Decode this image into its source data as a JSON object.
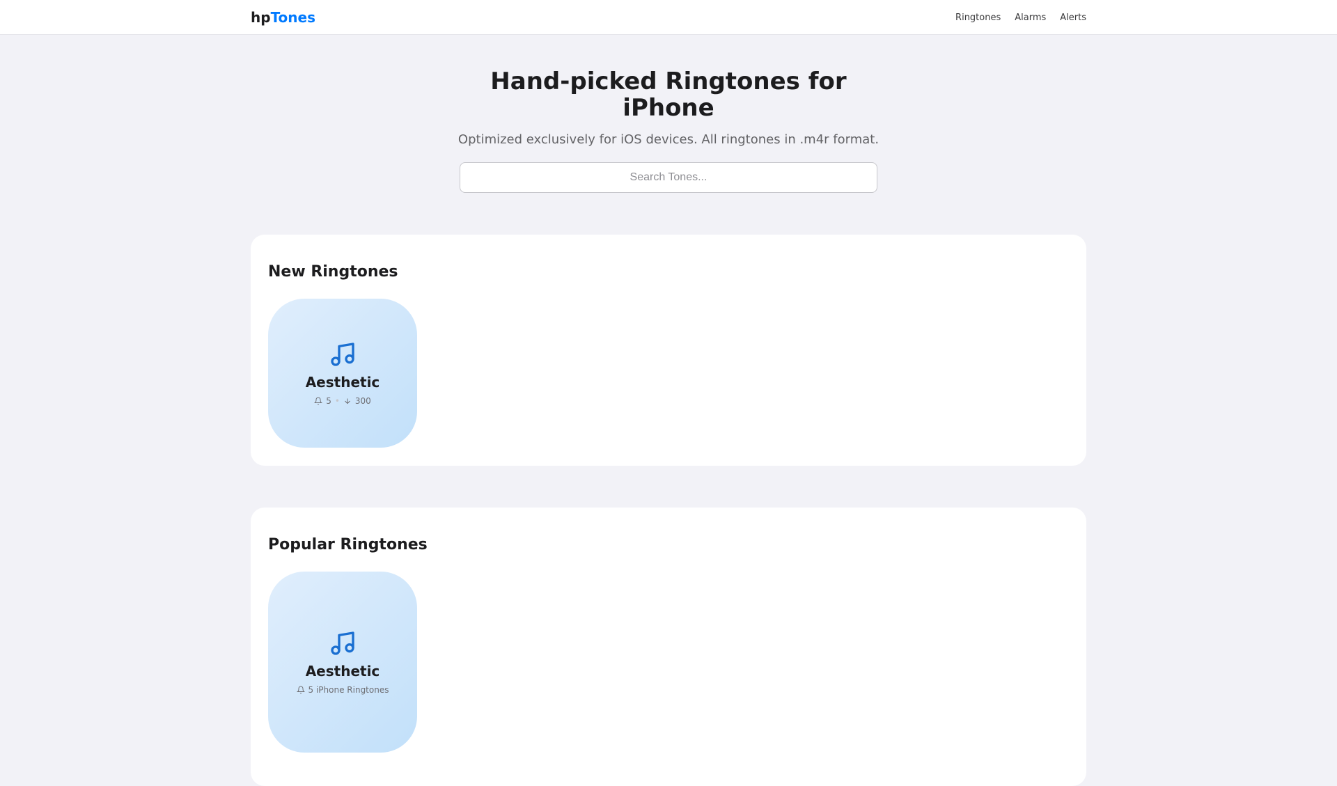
{
  "nav": {
    "logo_a": "hp",
    "logo_b": "Tones",
    "links": [
      "Ringtones",
      "Alarms",
      "Alerts"
    ]
  },
  "hero": {
    "title": "Hand-picked Ringtones for iPhone",
    "subtitle": "Optimized exclusively for iOS devices. All ringtones in .m4r format.",
    "search_placeholder": "Search Tones..."
  },
  "sections": [
    {
      "title": "New Ringtones",
      "items": [
        {
          "name": "Aesthetic",
          "count": "5",
          "downloads": "300"
        }
      ]
    },
    {
      "title": "Popular Ringtones",
      "items": [
        {
          "name": "Aesthetic",
          "count_label": "5 iPhone Ringtones"
        }
      ]
    }
  ],
  "colors": {
    "accent": "#007aff",
    "icon": "#1a6fd1"
  }
}
